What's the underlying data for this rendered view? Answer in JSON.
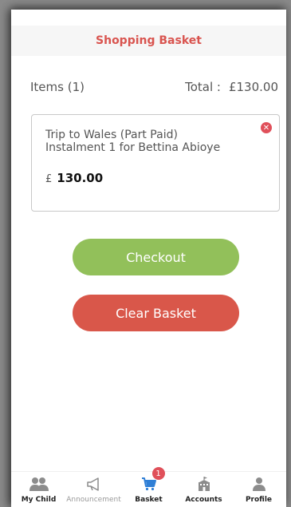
{
  "header": {
    "title": "Shopping Basket"
  },
  "summary": {
    "items_label": "Items (1)",
    "total_label": "Total :",
    "total_value": "£130.00"
  },
  "basket_items": [
    {
      "description_line1": "Trip to Wales (Part Paid)",
      "description_line2": "Instalment 1 for Bettina Abioye",
      "currency": "£",
      "amount": "130.00"
    }
  ],
  "actions": {
    "checkout_label": "Checkout",
    "clear_label": "Clear Basket"
  },
  "tabs": [
    {
      "label": "My Child",
      "icon": "children-icon"
    },
    {
      "label": "Announcement",
      "icon": "megaphone-icon"
    },
    {
      "label": "Basket",
      "icon": "cart-icon",
      "badge": "1"
    },
    {
      "label": "Accounts",
      "icon": "building-icon"
    },
    {
      "label": "Profile",
      "icon": "user-icon"
    }
  ],
  "colors": {
    "accent": "#d9544f",
    "checkout": "#92c05a",
    "clear": "#d9574a",
    "cart_icon": "#2f7fd6"
  }
}
